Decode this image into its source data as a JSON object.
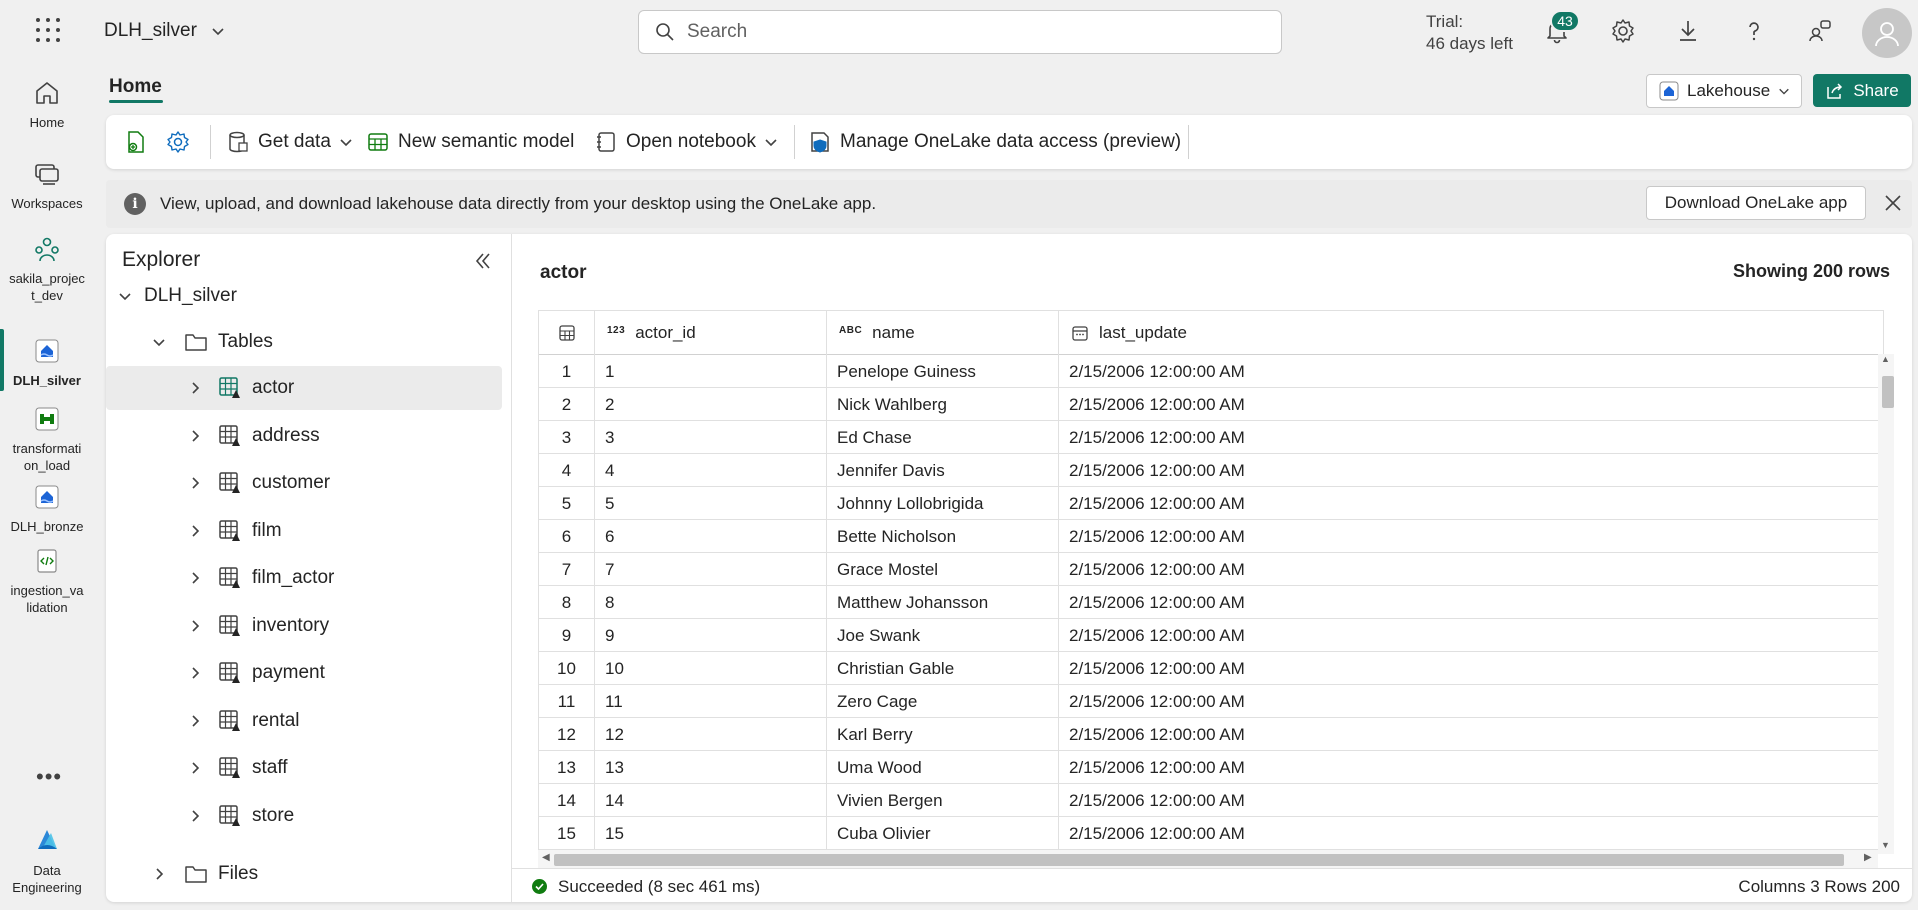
{
  "topbar": {
    "workspace": "DLH_silver",
    "search_placeholder": "Search",
    "trial_line1": "Trial:",
    "trial_line2": "46 days left",
    "notification_count": "43"
  },
  "rail": [
    {
      "label": "Home",
      "icon": "home-icon"
    },
    {
      "label": "Workspaces",
      "icon": "workspaces-icon"
    },
    {
      "label": "sakila_project_dev",
      "icon": "workspace-project-icon"
    },
    {
      "label": "DLH_silver",
      "icon": "lakehouse-icon"
    },
    {
      "label": "transformation_load",
      "icon": "pipeline-icon"
    },
    {
      "label": "DLH_bronze",
      "icon": "lakehouse-icon"
    },
    {
      "label": "ingestion_validation",
      "icon": "notebook-icon"
    },
    {
      "label": "Data Engineering",
      "icon": "data-engineering-icon"
    }
  ],
  "rail_labels": {
    "home": "Home",
    "workspaces": "Workspaces",
    "proj1": "sakila_projec",
    "proj2": "t_dev",
    "silver": "DLH_silver",
    "trans1": "transformati",
    "trans2": "on_load",
    "bronze": "DLH_bronze",
    "ingest1": "ingestion_va",
    "ingest2": "lidation",
    "de1": "Data",
    "de2": "Engineering",
    "more": "•••"
  },
  "header": {
    "home_tab": "Home",
    "lakehouse_btn": "Lakehouse",
    "share_btn": "Share"
  },
  "ribbon": {
    "get_data": "Get data",
    "new_semantic_model": "New semantic model",
    "open_notebook": "Open notebook",
    "manage_access": "Manage OneLake data access (preview)"
  },
  "infobar": {
    "message": "View, upload, and download lakehouse data directly from your desktop using the OneLake app.",
    "download_btn": "Download OneLake app"
  },
  "explorer": {
    "title": "Explorer",
    "root": "DLH_silver",
    "tables_folder": "Tables",
    "tables": [
      "actor",
      "address",
      "customer",
      "film",
      "film_actor",
      "inventory",
      "payment",
      "rental",
      "staff",
      "store"
    ],
    "files_folder": "Files"
  },
  "table_view": {
    "title": "actor",
    "showing": "Showing 200 rows",
    "columns": [
      {
        "type_tag": "123",
        "name": "actor_id"
      },
      {
        "type_tag": "ABC",
        "name": "name"
      },
      {
        "type_tag": "calendar",
        "name": "last_update"
      }
    ],
    "rows": [
      [
        "1",
        "1",
        "Penelope Guiness",
        "2/15/2006 12:00:00 AM"
      ],
      [
        "2",
        "2",
        "Nick Wahlberg",
        "2/15/2006 12:00:00 AM"
      ],
      [
        "3",
        "3",
        "Ed Chase",
        "2/15/2006 12:00:00 AM"
      ],
      [
        "4",
        "4",
        "Jennifer Davis",
        "2/15/2006 12:00:00 AM"
      ],
      [
        "5",
        "5",
        "Johnny Lollobrigida",
        "2/15/2006 12:00:00 AM"
      ],
      [
        "6",
        "6",
        "Bette Nicholson",
        "2/15/2006 12:00:00 AM"
      ],
      [
        "7",
        "7",
        "Grace Mostel",
        "2/15/2006 12:00:00 AM"
      ],
      [
        "8",
        "8",
        "Matthew Johansson",
        "2/15/2006 12:00:00 AM"
      ],
      [
        "9",
        "9",
        "Joe Swank",
        "2/15/2006 12:00:00 AM"
      ],
      [
        "10",
        "10",
        "Christian Gable",
        "2/15/2006 12:00:00 AM"
      ],
      [
        "11",
        "11",
        "Zero Cage",
        "2/15/2006 12:00:00 AM"
      ],
      [
        "12",
        "12",
        "Karl Berry",
        "2/15/2006 12:00:00 AM"
      ],
      [
        "13",
        "13",
        "Uma Wood",
        "2/15/2006 12:00:00 AM"
      ],
      [
        "14",
        "14",
        "Vivien Bergen",
        "2/15/2006 12:00:00 AM"
      ],
      [
        "15",
        "15",
        "Cuba Olivier",
        "2/15/2006 12:00:00 AM"
      ]
    ]
  },
  "status": {
    "left": "Succeeded (8 sec 461 ms)",
    "right": "Columns 3 Rows 200"
  },
  "colors": {
    "accent": "#117865",
    "success": "#107c10"
  }
}
